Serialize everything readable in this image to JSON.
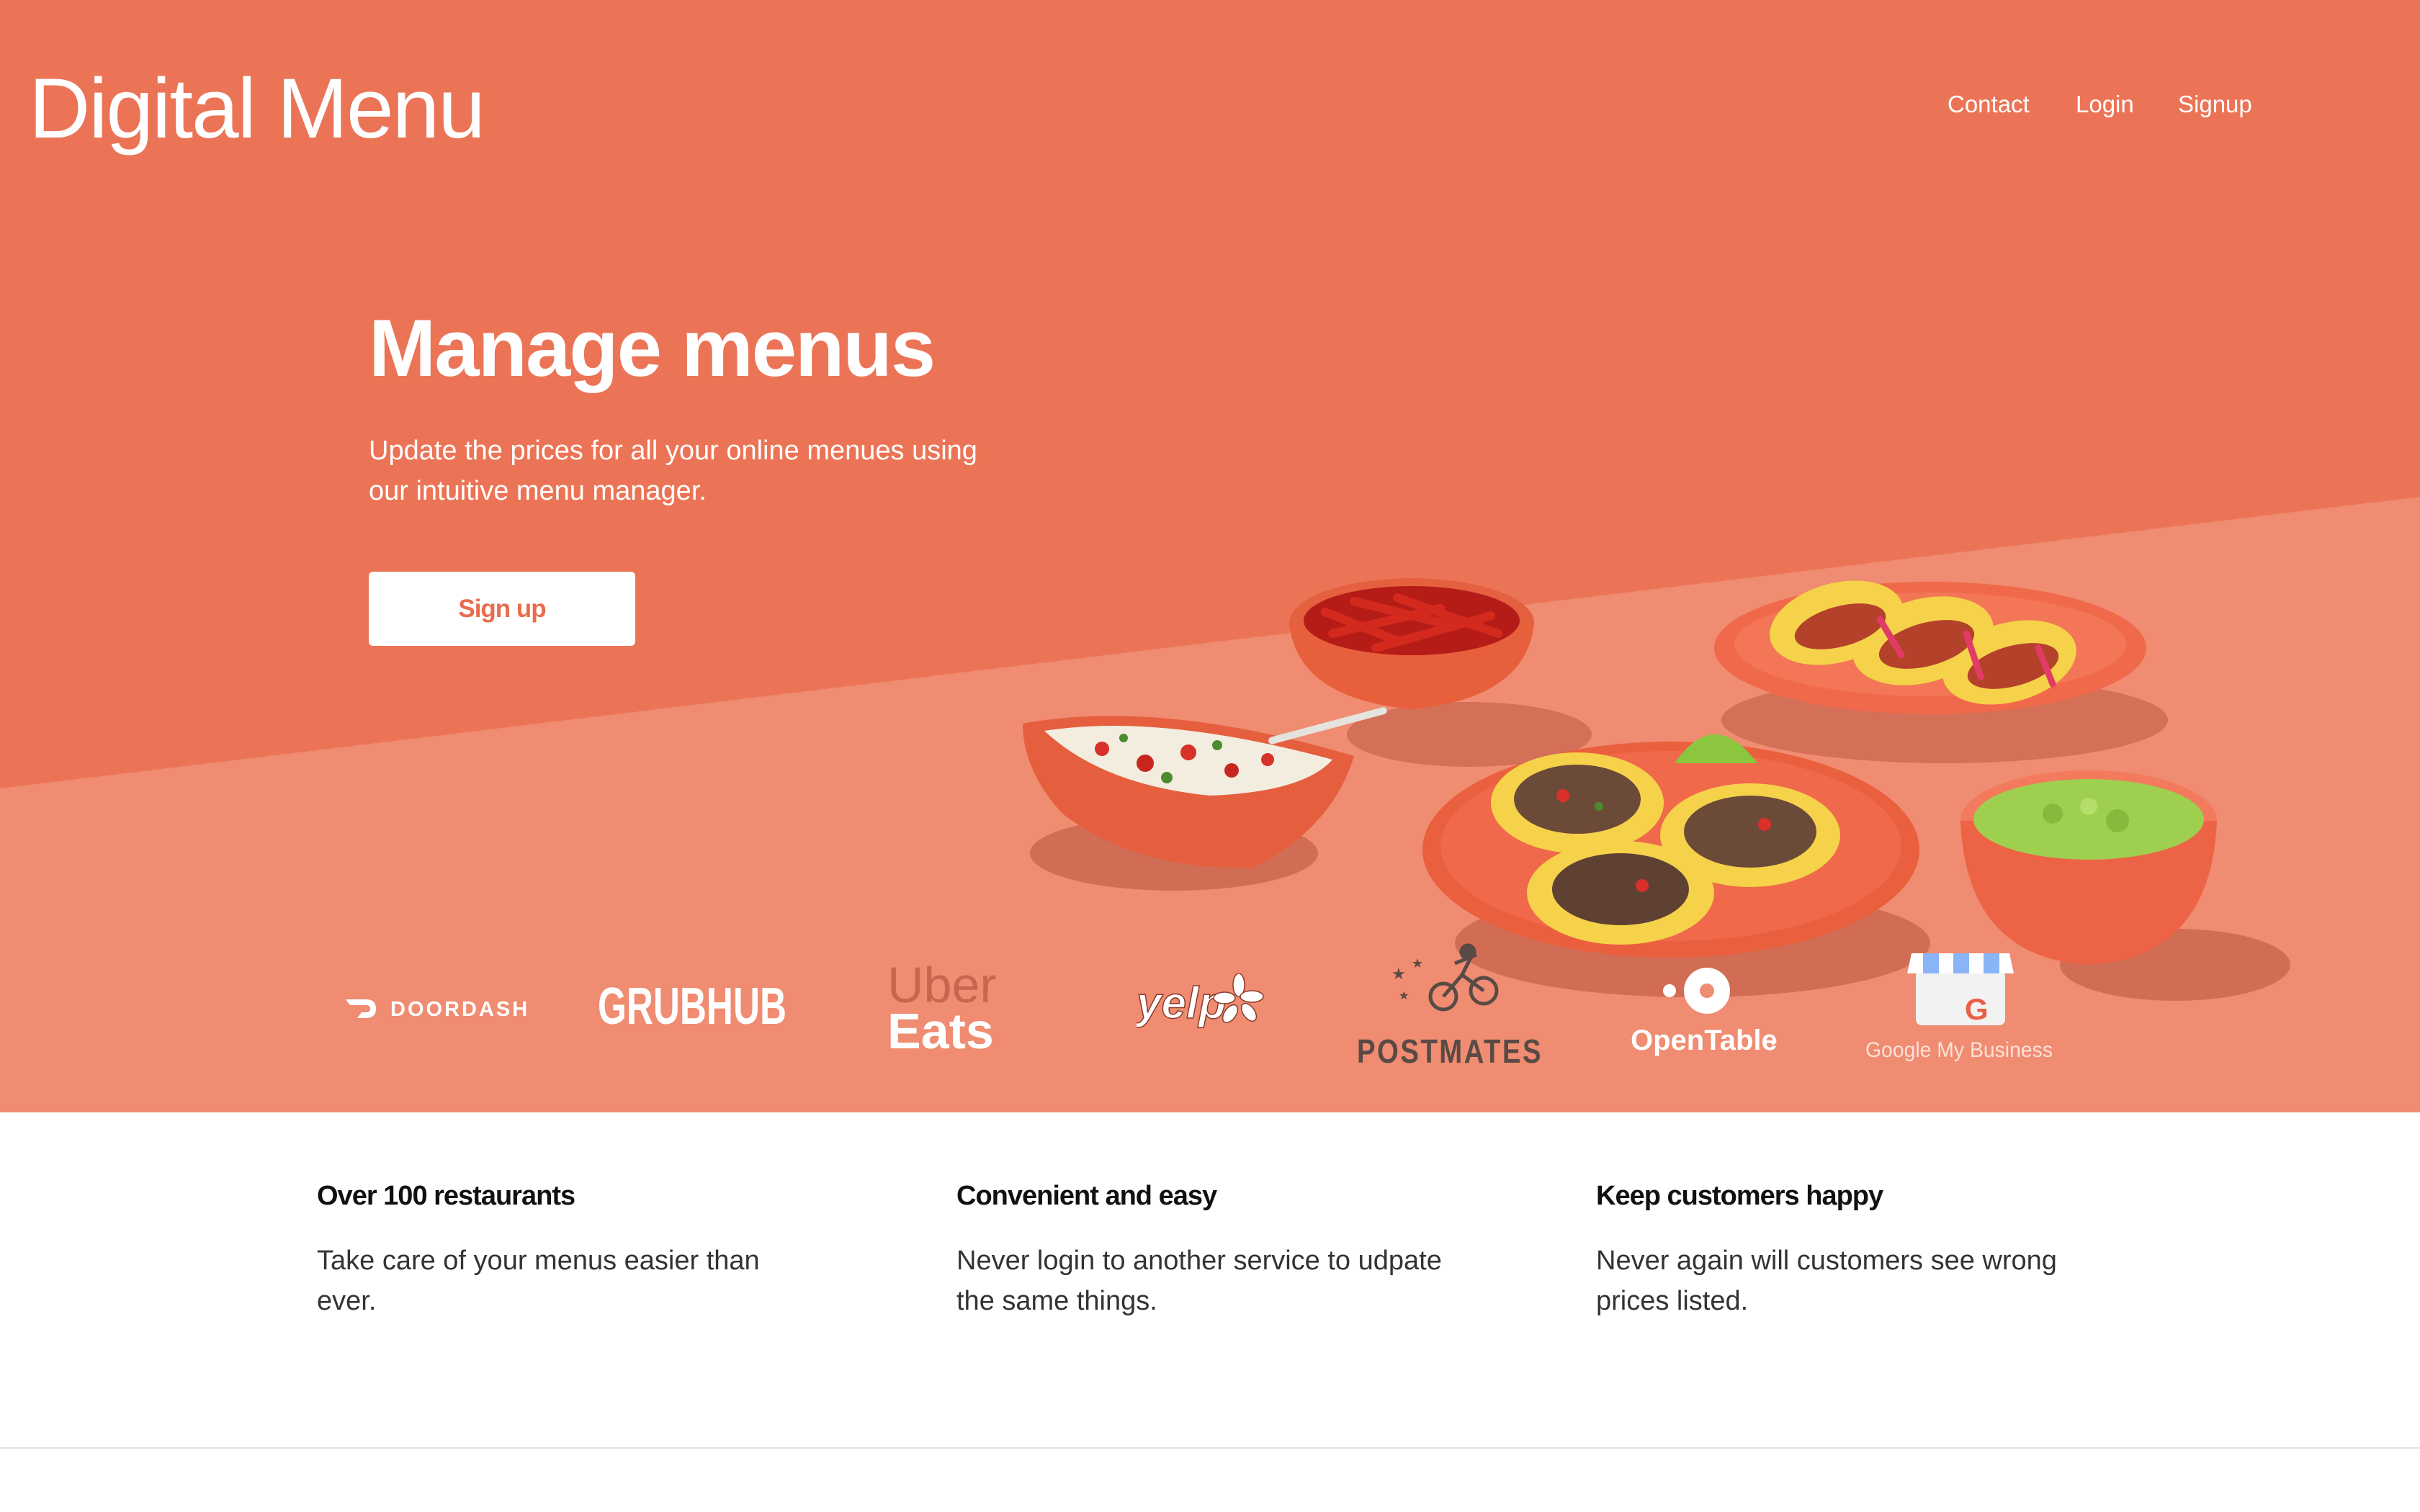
{
  "brand": {
    "title": "Digital Menu"
  },
  "nav": {
    "items": [
      "Contact",
      "Login",
      "Signup"
    ]
  },
  "hero": {
    "headline": "Manage menus",
    "subtext": "Update the prices for all your online menues using our intuitive menu manager.",
    "cta_label": "Sign up"
  },
  "partners": {
    "doordash": "DOORDASH",
    "grubhub": "GRUBHUB",
    "ubereats_line1": "Uber",
    "ubereats_line2": "Eats",
    "yelp": "yelp",
    "postmates": "POSTMATES",
    "opentable": "OpenTable",
    "google": "Google My Business"
  },
  "features": [
    {
      "title": "Over 100 restaurants",
      "body": "Take care of your menus easier than ever."
    },
    {
      "title": "Convenient and easy",
      "body": "Never login to another service to udpate the same things."
    },
    {
      "title": "Keep customers happy",
      "body": "Never again will customers see wrong prices listed."
    }
  ],
  "colors": {
    "accent": "#ec7456",
    "accent_light": "#ef8c71",
    "text_dark": "#111111"
  }
}
